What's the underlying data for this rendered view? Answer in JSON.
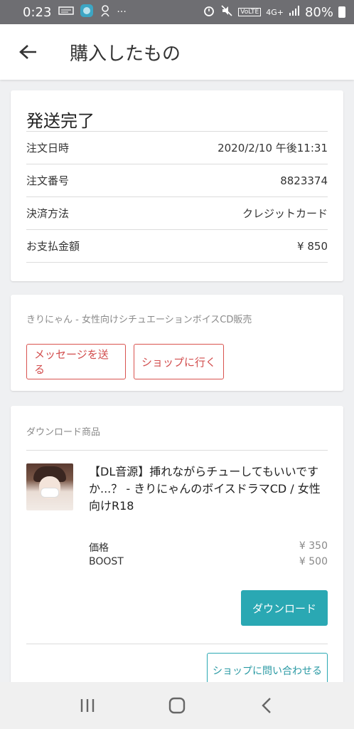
{
  "status_bar": {
    "time": "0:23",
    "left_icons": [
      "news-icon",
      "globe-icon",
      "hand-icon",
      "more-icon"
    ],
    "more_glyph": "···",
    "network": "4G+",
    "volte": "VoLTE",
    "battery": "80%"
  },
  "header": {
    "title": "購入したもの",
    "back_icon": "arrow-left-icon"
  },
  "order": {
    "status": "発送完了",
    "rows": [
      {
        "label": "注文日時",
        "value": "2020/2/10 午後11:31"
      },
      {
        "label": "注文番号",
        "value": "8823374"
      },
      {
        "label": "決済方法",
        "value": "クレジットカード"
      },
      {
        "label": "お支払金額",
        "value": "¥ 850"
      }
    ]
  },
  "shop": {
    "name": "きりにゃん - 女性向けシチュエーションボイスCD販売",
    "message_button": "メッセージを送る",
    "shop_button": "ショップに行く"
  },
  "download": {
    "heading": "ダウンロード商品",
    "product_title": "【DL音源】挿れながらチューしてもいいですか...？ - きりにゃんのボイスドラマCD / 女性向けR18",
    "prices": [
      {
        "label": "価格",
        "value": "¥ 350"
      },
      {
        "label": "BOOST",
        "value": "¥ 500"
      }
    ],
    "download_button": "ダウンロード",
    "contact_button": "ショップに問い合わせる"
  },
  "colors": {
    "accent_teal": "#2aa8b3",
    "accent_red": "#d24d4d",
    "status_bar": "#6e6e72"
  },
  "nav": {
    "recent_icon": "recent-apps-icon",
    "home_icon": "home-icon",
    "back_icon": "back-icon"
  }
}
